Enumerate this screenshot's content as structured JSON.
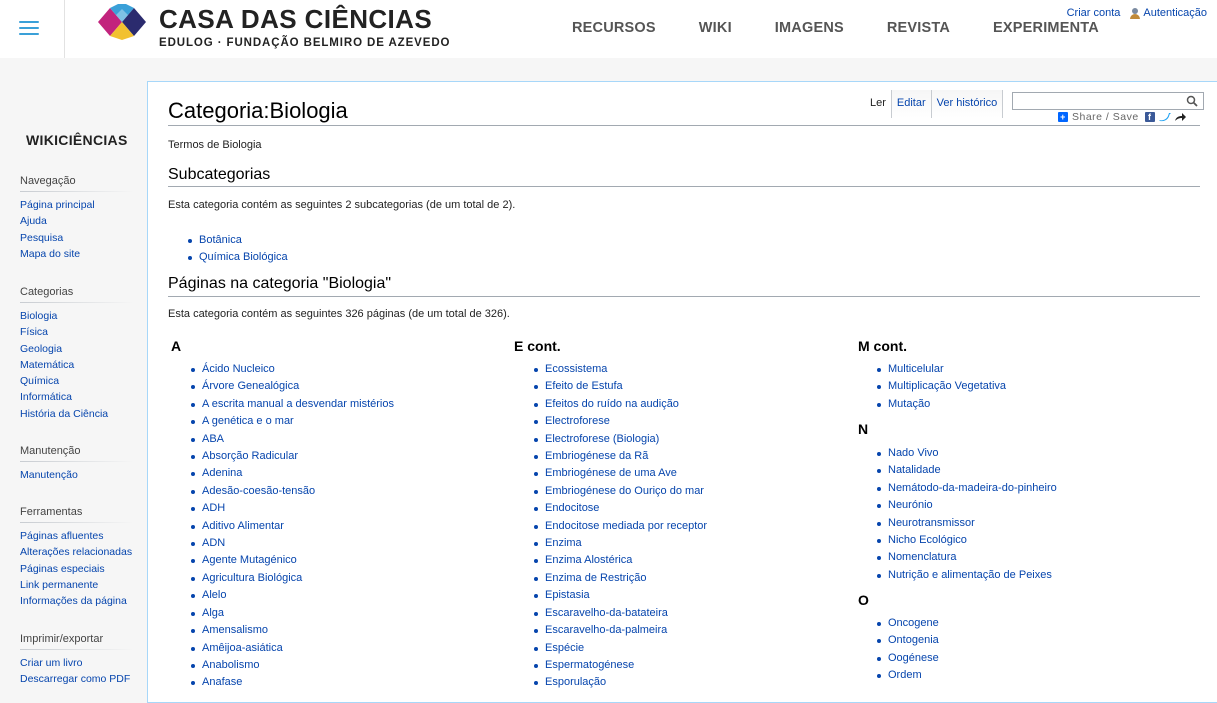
{
  "header": {
    "logo_title": "CASA DAS CIÊNCIAS",
    "logo_subtitle": "EDULOG · FUNDAÇÃO BELMIRO DE AZEVEDO",
    "nav": [
      "RECURSOS",
      "WIKI",
      "IMAGENS",
      "REVISTA",
      "EXPERIMENTA"
    ],
    "create_account": "Criar conta",
    "login": "Autenticação",
    "brand_colors": {
      "magenta": "#c2237d",
      "blue": "#3aa0d8",
      "yellow": "#f2c130",
      "dark": "#2b2b6e"
    }
  },
  "sidebar": {
    "wiki_name": "WIKICIÊNCIAS",
    "portals": [
      {
        "title": "Navegação",
        "items": [
          "Página principal",
          "Ajuda",
          "Pesquisa",
          "Mapa do site"
        ]
      },
      {
        "title": "Categorias",
        "items": [
          "Biologia",
          "Física",
          "Geologia",
          "Matemática",
          "Química",
          "Informática",
          "História da Ciência"
        ]
      },
      {
        "title": "Manutenção",
        "items": [
          "Manutenção"
        ]
      },
      {
        "title": "Ferramentas",
        "items": [
          "Páginas afluentes",
          "Alterações relacionadas",
          "Páginas especiais",
          "Link permanente",
          "Informações da página"
        ]
      },
      {
        "title": "Imprimir/exportar",
        "items": [
          "Criar um livro",
          "Descarregar como PDF"
        ]
      }
    ]
  },
  "tabs": [
    "Ler",
    "Editar",
    "Ver histórico"
  ],
  "search": {
    "placeholder": ""
  },
  "share": {
    "label": "Share / Save"
  },
  "page": {
    "title": "Categoria:Biologia",
    "tagline": "Termos de Biologia",
    "subcategories_heading": "Subcategorias",
    "subcategories_text": "Esta categoria contém as seguintes 2 subcategorias (de um total de 2).",
    "subcategories": [
      "Botânica",
      "Química Biológica"
    ],
    "pages_heading": "Páginas na categoria \"Biologia\"",
    "pages_text": "Esta categoria contém as seguintes 326 páginas (de um total de 326).",
    "columns": [
      {
        "groups": [
          {
            "letter": "A",
            "items": [
              "Ácido Nucleico",
              "Árvore Genealógica",
              "A escrita manual a desvendar mistérios",
              "A genética e o mar",
              "ABA",
              "Absorção Radicular",
              "Adenina",
              "Adesão-coesão-tensão",
              "ADH",
              "Aditivo Alimentar",
              "ADN",
              "Agente Mutagénico",
              "Agricultura Biológica",
              "Alelo",
              "Alga",
              "Amensalismo",
              "Amêijoa-asiática",
              "Anabolismo",
              "Anafase"
            ]
          }
        ]
      },
      {
        "groups": [
          {
            "letter": "E cont.",
            "items": [
              "Ecossistema",
              "Efeito de Estufa",
              "Efeitos do ruído na audição",
              "Electroforese",
              "Electroforese (Biologia)",
              "Embriogénese da Rã",
              "Embriogénese de uma Ave",
              "Embriogénese do Ouriço do mar",
              "Endocitose",
              "Endocitose mediada por receptor",
              "Enzima",
              "Enzima Alostérica",
              "Enzima de Restrição",
              "Epistasia",
              "Escaravelho-da-batateira",
              "Escaravelho-da-palmeira",
              "Espécie",
              "Espermatogénese",
              "Esporulação"
            ]
          }
        ]
      },
      {
        "groups": [
          {
            "letter": "M cont.",
            "items": [
              "Multicelular",
              "Multiplicação Vegetativa",
              "Mutação"
            ]
          },
          {
            "letter": "N",
            "items": [
              "Nado Vivo",
              "Natalidade",
              "Nemátodo-da-madeira-do-pinheiro",
              "Neurónio",
              "Neurotransmissor",
              "Nicho Ecológico",
              "Nomenclatura",
              "Nutrição e alimentação de Peixes"
            ]
          },
          {
            "letter": "O",
            "items": [
              "Oncogene",
              "Ontogenia",
              "Oogénese",
              "Ordem"
            ]
          }
        ]
      }
    ]
  }
}
